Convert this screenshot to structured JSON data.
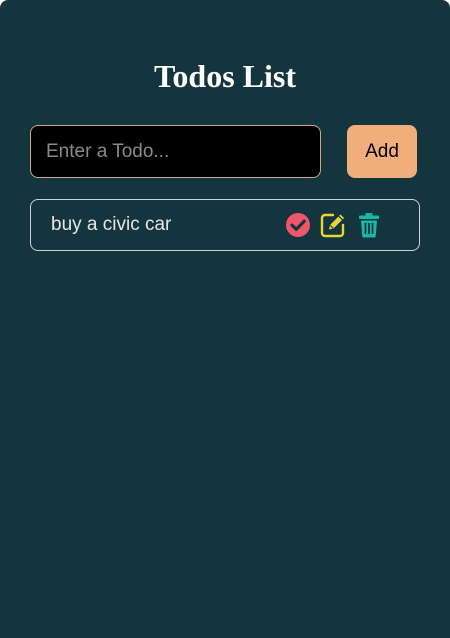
{
  "header": {
    "title": "Todos List"
  },
  "form": {
    "input_value": "",
    "input_placeholder": "Enter a Todo...",
    "add_label": "Add"
  },
  "todos": [
    {
      "text": "buy a civic car",
      "actions": [
        {
          "icon": "check-circle-icon",
          "color": "#f0566b"
        },
        {
          "icon": "edit-icon",
          "color": "#e8d53e"
        },
        {
          "icon": "trash-icon",
          "color": "#19b7a4"
        }
      ]
    }
  ],
  "colors": {
    "background": "#14353d",
    "accent": "#f1ae7d",
    "input_bg": "#000000",
    "input_border": "#caa98b",
    "item_border": "#c9d3d5",
    "title_text": "#ffffff",
    "item_text": "#e6e6e6"
  }
}
